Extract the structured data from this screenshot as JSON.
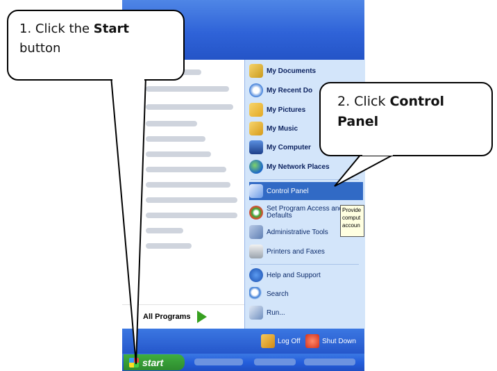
{
  "callouts": {
    "step1": {
      "prefix": "1. Click the ",
      "bold": "Start",
      "suffix": "button"
    },
    "step2": {
      "prefix": "2. Click ",
      "bold": "Control",
      "bold2": "Panel"
    }
  },
  "start_menu": {
    "right_items_top": [
      {
        "label": "My Documents",
        "icon": "my-documents-icon"
      },
      {
        "label": "My Recent Do",
        "icon": "my-recent-documents-icon"
      },
      {
        "label": "My Pictures",
        "icon": "my-pictures-icon"
      },
      {
        "label": "My Music",
        "icon": "my-music-icon"
      },
      {
        "label": "My Computer",
        "icon": "my-computer-icon"
      },
      {
        "label": "My Network Places",
        "icon": "my-network-places-icon"
      }
    ],
    "control_panel": "Control Panel",
    "right_items_mid": [
      {
        "label": "Set Program Access and",
        "label2": "Defaults",
        "icon": "program-access-icon"
      },
      {
        "label": "Administrative Tools",
        "icon": "admin-tools-icon"
      },
      {
        "label": "Printers and Faxes",
        "icon": "printers-icon"
      }
    ],
    "right_items_bottom": [
      {
        "label": "Help and Support",
        "icon": "help-icon"
      },
      {
        "label": "Search",
        "icon": "search-icon"
      },
      {
        "label": "Run...",
        "icon": "run-icon"
      }
    ],
    "tooltip": {
      "line1": "Provide",
      "line2": "comput",
      "line3": "accoun"
    },
    "all_programs": "All Programs",
    "log_off": "Log Off",
    "shut_down": "Shut Down"
  },
  "taskbar": {
    "start_label": "start"
  },
  "colors": {
    "selection": "#316ac5",
    "right_pane": "#d3e5fa",
    "start_green": "#2e8b2e",
    "xp_blue": "#245edb"
  }
}
